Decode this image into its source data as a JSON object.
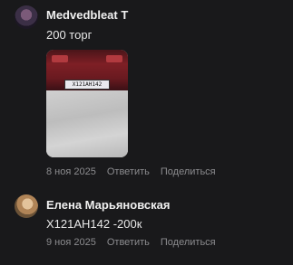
{
  "comments": [
    {
      "author": "Medvedbleat T",
      "text": "200 торг",
      "date": "8 ноя 2025",
      "reply_label": "Ответить",
      "share_label": "Поделиться",
      "photo": {
        "plate_text": "Х121АН142"
      }
    },
    {
      "author": "Елена Марьяновская",
      "text": "Х121АН142 -200к",
      "date": "9 ноя 2025",
      "reply_label": "Ответить",
      "share_label": "Поделиться"
    }
  ]
}
